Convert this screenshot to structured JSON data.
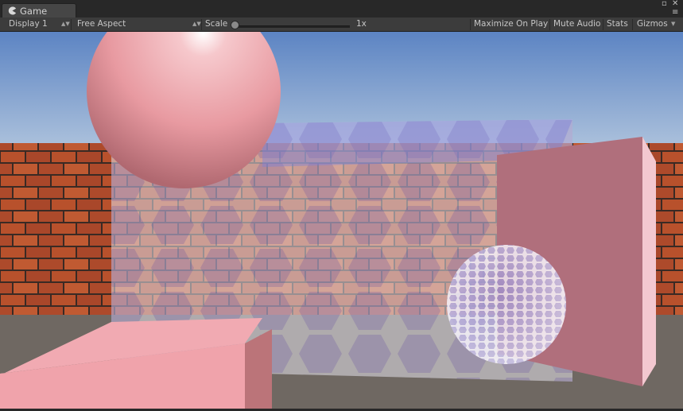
{
  "tab": {
    "label": "Game",
    "icon": "pacman-game-icon"
  },
  "window_controls": {
    "maximize": "▫",
    "close": "✕",
    "menu": "≡"
  },
  "toolbar": {
    "display": "Display 1",
    "aspect": "Free Aspect",
    "scale_label": "Scale",
    "scale_value": "1x",
    "scale_level": 0.0,
    "maximize_on_play": "Maximize On Play",
    "mute_audio": "Mute Audio",
    "stats": "Stats",
    "gizmos": "Gizmos"
  },
  "colors": {
    "sky_top": "#5f87c5",
    "sky_bottom": "#a6bcd9",
    "brick": "#b5522e",
    "ground": "#6e6761",
    "pink": "#e9a0a8",
    "forcefield": "#c8c8e8"
  },
  "scene": {
    "objects": [
      "pink-sphere",
      "brick-wall",
      "hex-forcefield",
      "pink-cube-left",
      "pink-cube-right",
      "hex-sphere",
      "ground-plane"
    ]
  }
}
